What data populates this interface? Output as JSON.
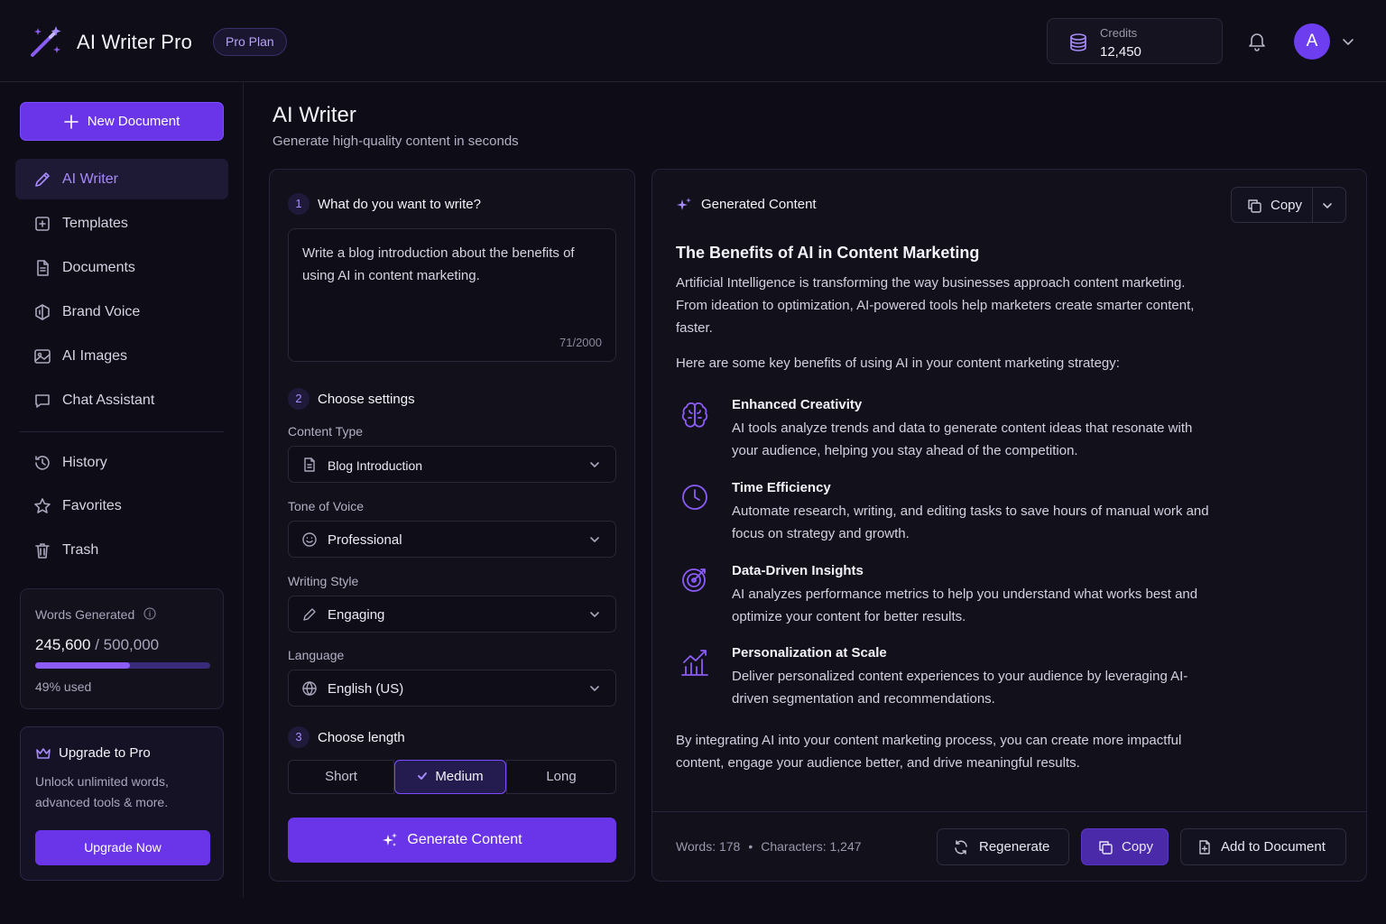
{
  "header": {
    "app_title": "AI Writer Pro",
    "plan_badge": "Pro Plan",
    "credits_label": "Credits",
    "credits_value": "12,450",
    "avatar_letter": "A"
  },
  "sidebar": {
    "new_document": "New Document",
    "items": [
      {
        "label": "AI Writer",
        "icon": "pen-icon",
        "active": true
      },
      {
        "label": "Templates",
        "icon": "template-icon"
      },
      {
        "label": "Documents",
        "icon": "document-icon"
      },
      {
        "label": "Brand Voice",
        "icon": "brand-voice-icon"
      },
      {
        "label": "AI Images",
        "icon": "image-icon"
      },
      {
        "label": "Chat Assistant",
        "icon": "chat-icon"
      }
    ],
    "secondary_items": [
      {
        "label": "History",
        "icon": "history-icon"
      },
      {
        "label": "Favorites",
        "icon": "star-icon"
      },
      {
        "label": "Trash",
        "icon": "trash-icon"
      }
    ],
    "words": {
      "title": "Words Generated",
      "used": "245,600",
      "separator": "/",
      "total": "500,000",
      "used_fraction": 0.49,
      "used_text": "49% used"
    },
    "upgrade": {
      "title": "Upgrade to Pro",
      "description": "Unlock unlimited words, advanced tools & more.",
      "button": "Upgrade Now"
    }
  },
  "main": {
    "title": "AI Writer",
    "subtitle": "Generate high-quality content in seconds"
  },
  "form": {
    "step1": {
      "num": "1",
      "label": "What do you want to write?"
    },
    "prompt": "Write a blog introduction about the benefits of using AI in content marketing.",
    "char_count": "71/2000",
    "step2": {
      "num": "2",
      "label": "Choose settings"
    },
    "content_type": {
      "label": "Content Type",
      "value": "Blog Introduction"
    },
    "tone": {
      "label": "Tone of Voice",
      "value": "Professional"
    },
    "style": {
      "label": "Writing Style",
      "value": "Engaging"
    },
    "language": {
      "label": "Language",
      "value": "English (US)"
    },
    "step3": {
      "num": "3",
      "label": "Choose length"
    },
    "length_options": {
      "short": "Short",
      "medium": "Medium",
      "long": "Long",
      "selected": "Medium"
    },
    "generate_button": "Generate Content"
  },
  "output": {
    "header": "Generated Content",
    "copy_label": "Copy",
    "title": "The Benefits of AI in Content Marketing",
    "intro": "Artificial Intelligence is transforming the way businesses approach content marketing. From ideation to optimization, AI-powered tools help marketers create smarter content, faster.",
    "lead": "Here are some key benefits of using AI in your content marketing strategy:",
    "benefits": [
      {
        "icon": "brain-icon",
        "title": "Enhanced Creativity",
        "desc": "AI tools analyze trends and data to generate content ideas that resonate with your audience, helping you stay ahead of the competition."
      },
      {
        "icon": "clock-icon",
        "title": "Time Efficiency",
        "desc": "Automate research, writing, and editing tasks to save hours of manual work and focus on strategy and growth."
      },
      {
        "icon": "target-icon",
        "title": "Data-Driven Insights",
        "desc": "AI analyzes performance metrics to help you understand what works best and optimize your content for better results."
      },
      {
        "icon": "growth-chart-icon",
        "title": "Personalization at Scale",
        "desc": "Deliver personalized content experiences to your audience by leveraging AI-driven segmentation and recommendations."
      }
    ],
    "conclusion": "By integrating AI into your content marketing process, you can create more impactful content, engage your audience better, and drive meaningful results.",
    "words_stat": "Words: 178",
    "stat_separator": "•",
    "chars_stat": "Characters: 1,247",
    "regenerate": "Regenerate",
    "copy_button": "Copy",
    "add_to_document": "Add to Document"
  },
  "colors": {
    "accent": "#6a35e8",
    "accent_light": "#a78bfa",
    "background": "#0d0c17",
    "panel": "#11101b"
  }
}
